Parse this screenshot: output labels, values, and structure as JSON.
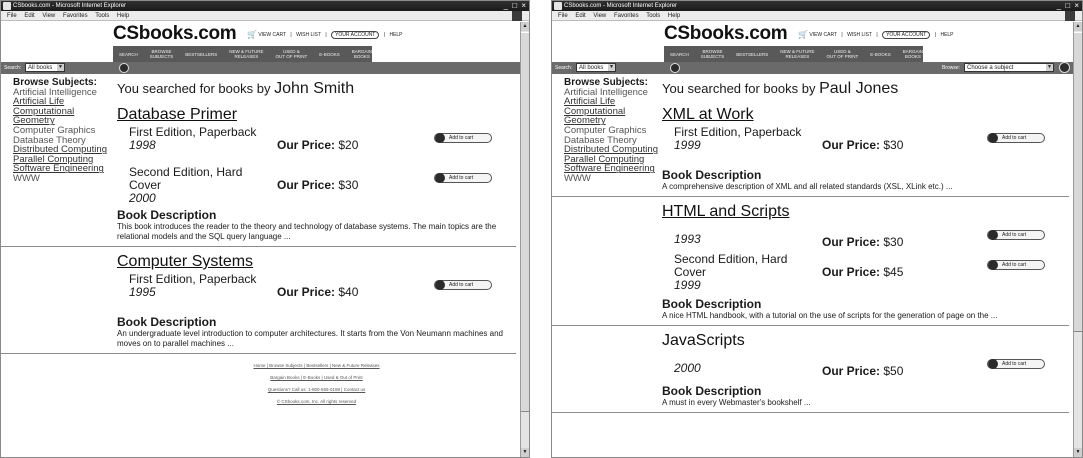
{
  "browser": {
    "title": "CSbooks.com - Microsoft Internet Explorer",
    "menu": [
      "File",
      "Edit",
      "View",
      "Favorites",
      "Tools",
      "Help"
    ],
    "window_controls": "_ □ ×"
  },
  "site": {
    "logo": "CSbooks.com",
    "toplinks": [
      "VIEW CART",
      "WISH LIST",
      "YOUR ACCOUNT",
      "HELP"
    ],
    "nav": [
      "SEARCH",
      "BROWSE\nSUBJECTS",
      "BESTSELLERS",
      "NEW & FUTURE\nRELEASES",
      "USED &\nOUT OF PRINT",
      "E-BOOKS",
      "BARGAIN\nBOOKS"
    ],
    "search_label": "Search:",
    "search_select": "All books",
    "browse_label": "Browse:",
    "browse_select": "Choose a subject"
  },
  "sidebar": {
    "heading": "Browse Subjects:",
    "items": [
      {
        "label": "Artificial Intelligence",
        "link": false
      },
      {
        "label": "Artificial Life",
        "link": true
      },
      {
        "label": "Computational",
        "link": true
      },
      {
        "label": "Geometry",
        "link": true
      },
      {
        "label": "Computer Graphics",
        "link": false
      },
      {
        "label": "Database Theory",
        "link": false
      },
      {
        "label": "Distributed Computing",
        "link": true
      },
      {
        "label": "Parallel Computing",
        "link": true
      },
      {
        "label": "Software Engineering",
        "link": true
      },
      {
        "label": "WWW",
        "link": false
      }
    ]
  },
  "add_to_cart_label": "Add to cart",
  "price_label": "Our Price:",
  "description_label": "Book Description",
  "left": {
    "searched_prefix": "You searched for books by",
    "author": "John Smith",
    "books": [
      {
        "title": "Database Primer",
        "editions": [
          {
            "edition": "First Edition, Paperback",
            "year": "1998",
            "price": "$20"
          },
          {
            "edition": "Second Edition, Hard Cover",
            "year": "2000",
            "price": "$30"
          }
        ],
        "description": "This book introduces the reader to the theory and technology of database systems. The main topics are the relational models and the SQL query language ..."
      },
      {
        "title": "Computer Systems",
        "editions": [
          {
            "edition": "First Edition, Paperback",
            "year": "1995",
            "price": "$40"
          }
        ],
        "description": "An undergraduate level introduction to computer architectures. It starts from the Von Neumann machines and moves on to parallel machines ..."
      }
    ],
    "footer": [
      "Home | Browse Subjects | Bestsellers | New & Future Releases",
      "Bargain Books | E-Books | Used & Out of Print",
      "Questions? Call us: 1-800-555-0199 | Contact us",
      "© CSbooks.com, Inc. All rights reserved"
    ]
  },
  "right": {
    "searched_prefix": "You searched for books by",
    "author": "Paul Jones",
    "books": [
      {
        "title": "XML at Work",
        "underline": true,
        "editions": [
          {
            "edition": "First Edition, Paperback",
            "year": "1999",
            "price": "$30"
          }
        ],
        "description": "A comprehensive description of XML and all related standards (XSL, XLink etc.) ..."
      },
      {
        "title": "HTML and Scripts",
        "underline": true,
        "editions": [
          {
            "edition": "",
            "year": "1993",
            "price": "$30"
          },
          {
            "edition": "Second Edition, Hard Cover",
            "year": "1999",
            "price": "$45"
          }
        ],
        "description": "A nice HTML handbook, with a tutorial on the use of scripts for the generation of page on the ..."
      },
      {
        "title": "JavaScripts",
        "underline": false,
        "editions": [
          {
            "edition": "",
            "year": "2000",
            "price": "$50"
          }
        ],
        "description": "A must in every Webmaster's bookshelf ..."
      }
    ]
  }
}
